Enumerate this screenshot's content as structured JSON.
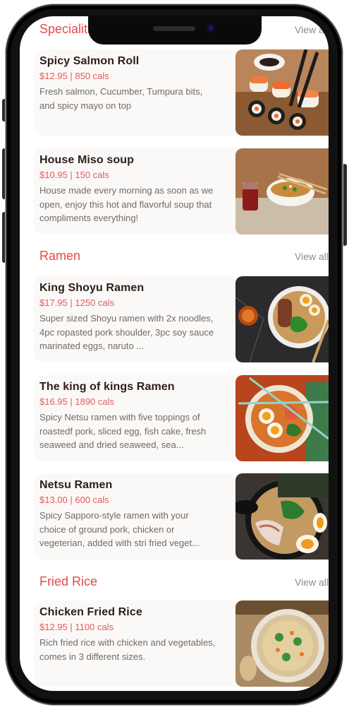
{
  "sections": [
    {
      "title": "Specialities",
      "view_all": "View all",
      "items": [
        {
          "name": "Spicy Salmon Roll",
          "price": "$12.95 | 850 cals",
          "desc": "Fresh salmon, Cucumber, Tumpura bits, and spicy mayo on top",
          "image": "sushi-image"
        },
        {
          "name": "House Miso soup",
          "price": "$10.95 | 150 cals",
          "desc": "House made every morning as soon as we open, enjoy this hot and flavorful soup that compliments everything!",
          "image": "miso-soup-image"
        }
      ]
    },
    {
      "title": "Ramen",
      "view_all": "View all",
      "items": [
        {
          "name": "King Shoyu Ramen",
          "price": "$17.95 | 1250 cals",
          "desc": "Super sized Shoyu ramen with 2x noodles, 4pc ropasted pork shoulder, 3pc soy sauce marinated eggs, naruto ...",
          "image": "shoyu-ramen-image"
        },
        {
          "name": "The king of kings Ramen",
          "price": "$16.95 | 1890 cals",
          "desc": "Spicy Netsu ramen with five toppings of roastedf pork, sliced egg, fish  cake, fresh seaweed and dried seaweed, sea...",
          "image": "netsu-ramen-image"
        },
        {
          "name": "Netsu Ramen",
          "price": "$13.00 | 600 cals",
          "desc": "Spicy Sapporo-style ramen with your choice of ground pork, chicken or vegeterian, added with stri fried veget...",
          "image": "sapporo-ramen-image"
        }
      ]
    },
    {
      "title": "Fried Rice",
      "view_all": "View all",
      "items": [
        {
          "name": "Chicken Fried Rice",
          "price": "$12.95 | 1100 cals",
          "desc": "Rich fried rice with chicken and vegetables, comes in 3 different sizes.",
          "image": "fried-rice-image"
        }
      ]
    }
  ],
  "colors": {
    "accent": "#e24a4a",
    "price": "#e05c5c",
    "card_bg": "#fbf9f7"
  }
}
